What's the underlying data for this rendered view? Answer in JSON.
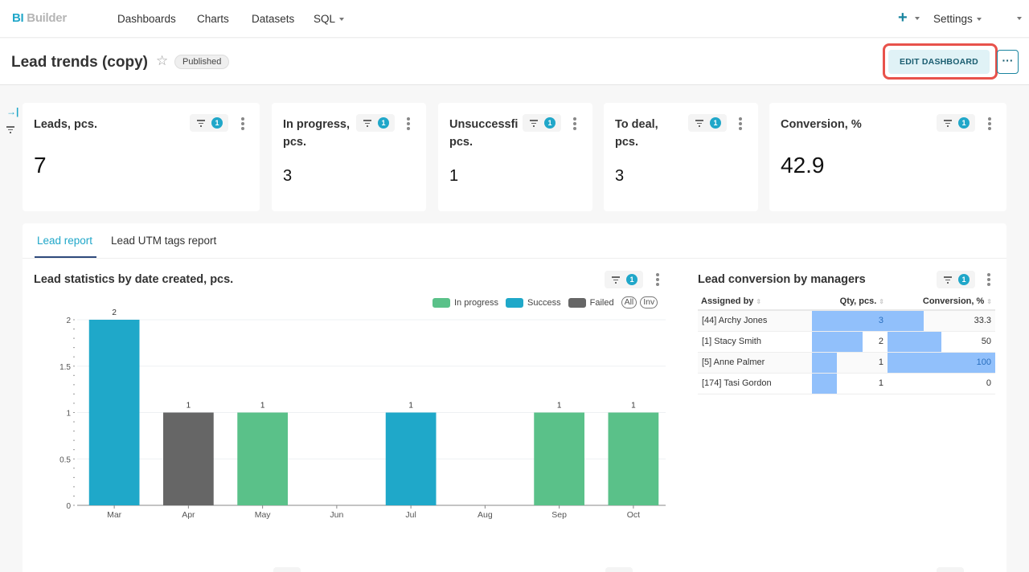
{
  "app": {
    "logo_prefix": "BI",
    "logo_suffix": "Builder"
  },
  "nav": {
    "items": [
      {
        "label": "Dashboards"
      },
      {
        "label": "Charts"
      },
      {
        "label": "Datasets"
      },
      {
        "label": "SQL",
        "has_dropdown": true
      }
    ],
    "add_label": "+",
    "settings_label": "Settings"
  },
  "header": {
    "title": "Lead trends (copy)",
    "status_badge": "Published",
    "edit_button": "EDIT DASHBOARD",
    "more_button": "···",
    "highlight_color": "#e8524b"
  },
  "rail": {
    "expand_icon": "→|"
  },
  "kpis": [
    {
      "title_line1": "Leads, pcs.",
      "title_line2": "",
      "value": "7",
      "filter_count": "1"
    },
    {
      "title_line1": "In progress,",
      "title_line2": "pcs.",
      "value": "3",
      "filter_count": "1"
    },
    {
      "title_line1": "Unsuccessfi",
      "title_line2": "pcs.",
      "value": "1",
      "filter_count": "1"
    },
    {
      "title_line1": "To deal,",
      "title_line2": "pcs.",
      "value": "3",
      "filter_count": "1"
    },
    {
      "title_line1": "Conversion, %",
      "title_line2": "",
      "value": "42.9",
      "filter_count": "1"
    }
  ],
  "tabs": [
    {
      "label": "Lead report",
      "active": true
    },
    {
      "label": "Lead UTM tags report",
      "active": false
    }
  ],
  "bar_chart_panel": {
    "title": "Lead statistics by date created, pcs.",
    "filter_count": "1",
    "legend_all": "All",
    "legend_inv": "Inv"
  },
  "chart_data": {
    "type": "bar",
    "title": "Lead statistics by date created, pcs.",
    "xlabel": "",
    "ylabel": "",
    "categories": [
      "Mar",
      "Apr",
      "May",
      "Jun",
      "Jul",
      "Aug",
      "Sep",
      "Oct"
    ],
    "series": [
      {
        "name": "In progress",
        "color": "#5ac189",
        "values": [
          0,
          0,
          1,
          0,
          0,
          0,
          1,
          1
        ]
      },
      {
        "name": "Success",
        "color": "#1fa8c9",
        "values": [
          2,
          0,
          0,
          0,
          1,
          0,
          0,
          0
        ]
      },
      {
        "name": "Failed",
        "color": "#666666",
        "values": [
          0,
          1,
          0,
          0,
          0,
          0,
          0,
          0
        ]
      }
    ],
    "totals": [
      2,
      1,
      1,
      0,
      1,
      0,
      1,
      1
    ],
    "yticks": [
      "0",
      "0.5",
      "1",
      "1.5",
      "2"
    ],
    "ylim": [
      0,
      2
    ],
    "grid": true,
    "legend_position": "top-right"
  },
  "table_panel": {
    "title": "Lead conversion by managers",
    "filter_count": "1",
    "columns": [
      "Assigned by",
      "Qty, pcs.",
      "Conversion, %"
    ],
    "rows": [
      {
        "name": "[44] Archy Jones",
        "qty": "3",
        "qty_value": 3,
        "conv": "33.3",
        "conv_value": 33.3
      },
      {
        "name": "[1] Stacy Smith",
        "qty": "2",
        "qty_value": 2,
        "conv": "50",
        "conv_value": 50
      },
      {
        "name": "[5] Anne Palmer",
        "qty": "1",
        "qty_value": 1,
        "conv": "100",
        "conv_value": 100
      },
      {
        "name": "[174] Tasi Gordon",
        "qty": "1",
        "qty_value": 1,
        "conv": "0",
        "conv_value": 0
      }
    ],
    "bar_color": "#91c0fb"
  }
}
